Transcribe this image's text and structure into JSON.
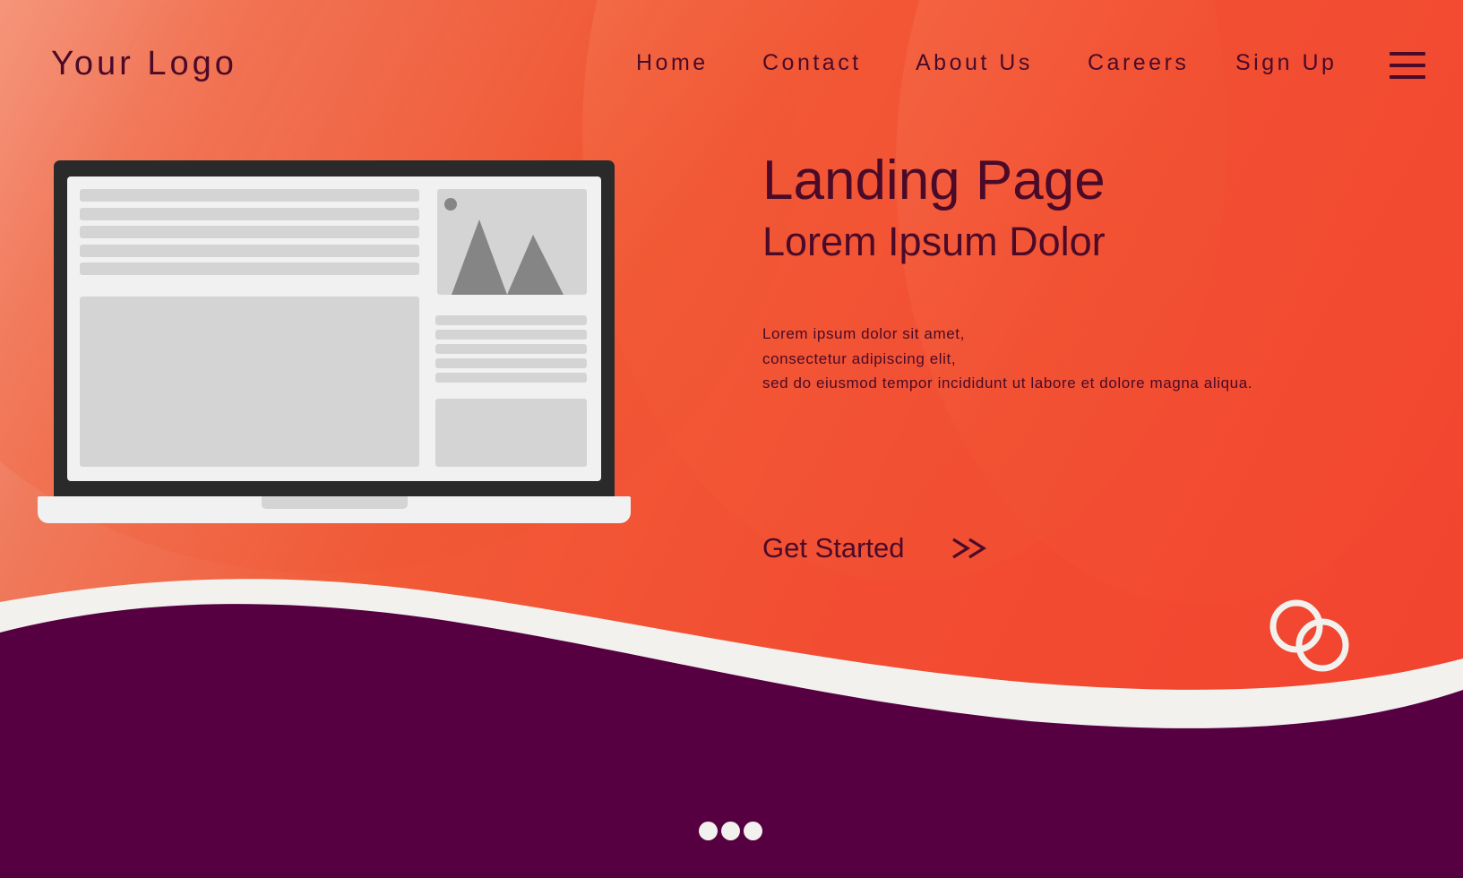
{
  "colors": {
    "primary_orange": "#f24a31",
    "dark_purple": "#560042",
    "text_dark": "#4a0a28",
    "cream": "#f3f1ee",
    "laptop_frame": "#2a2a2a",
    "screen_bg": "#f1f1f1",
    "placeholder_gray": "#d4d4d5",
    "image_icon_gray": "#858585"
  },
  "header": {
    "logo": "Your Logo",
    "nav": [
      {
        "label": "Home"
      },
      {
        "label": "Contact"
      },
      {
        "label": "About Us"
      },
      {
        "label": "Careers"
      },
      {
        "label": "Sign Up"
      }
    ],
    "menu_icon": "hamburger-menu-icon"
  },
  "hero": {
    "title": "Landing Page",
    "subtitle": "Lorem Ipsum Dolor",
    "body_lines": [
      "Lorem ipsum dolor sit amet,",
      "consectetur adipiscing elit,",
      "sed do eiusmod tempor incididunt ut labore et dolore magna aliqua."
    ],
    "cta_label": "Get Started",
    "cta_icon": "double-chevron-right-icon"
  },
  "illustration": {
    "device": "laptop",
    "screen_icon": "image-placeholder-icon"
  },
  "decor": {
    "rings_icon": "interlocking-rings-icon"
  },
  "pagination": {
    "dots": 3
  }
}
